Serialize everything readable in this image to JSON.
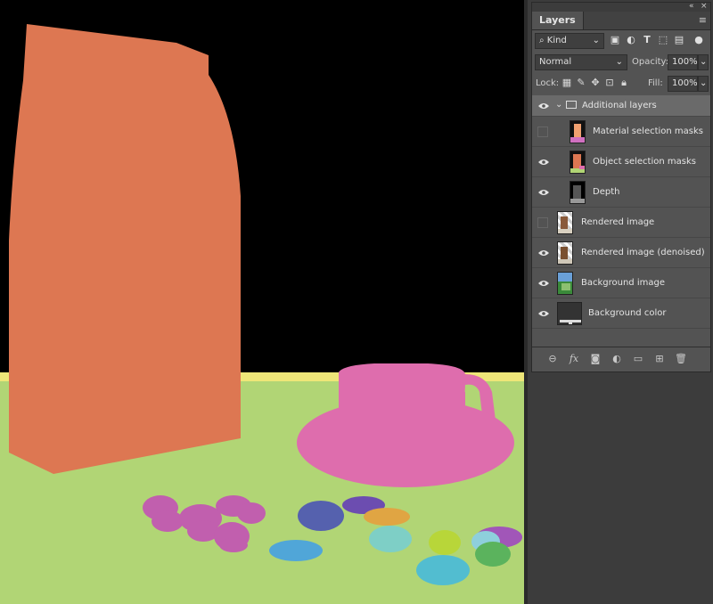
{
  "panel": {
    "collapse_glyph": "«",
    "close_glyph": "×",
    "tab_label": "Layers",
    "menu_glyph": "≡",
    "filter_kind": "Kind",
    "blend_mode": "Normal",
    "opacity_label": "Opacity:",
    "opacity_value": "100%",
    "lock_label": "Lock:",
    "fill_label": "Fill:",
    "fill_value": "100%",
    "layers": [
      {
        "name": "Additional layers",
        "type": "group",
        "visible": true
      },
      {
        "name": "Material selection masks",
        "type": "child",
        "visible": false
      },
      {
        "name": "Object selection masks",
        "type": "child",
        "visible": true
      },
      {
        "name": "Depth",
        "type": "child",
        "visible": true
      },
      {
        "name": "Rendered image",
        "type": "layer",
        "visible": false
      },
      {
        "name": "Rendered image (denoised)",
        "type": "layer",
        "visible": true
      },
      {
        "name": "Background image",
        "type": "layer",
        "visible": true
      },
      {
        "name": "Background color",
        "type": "layer",
        "visible": true
      }
    ],
    "footer_icons": [
      "link-icon",
      "fx-icon",
      "mask-icon",
      "adjustment-icon",
      "folder-icon",
      "new-layer-icon",
      "trash-icon"
    ]
  },
  "colors": {
    "bag": "#dd7752",
    "cup": "#de6dad",
    "table": "#b1d575",
    "table_edge": "#eee678",
    "background": "#000000"
  }
}
